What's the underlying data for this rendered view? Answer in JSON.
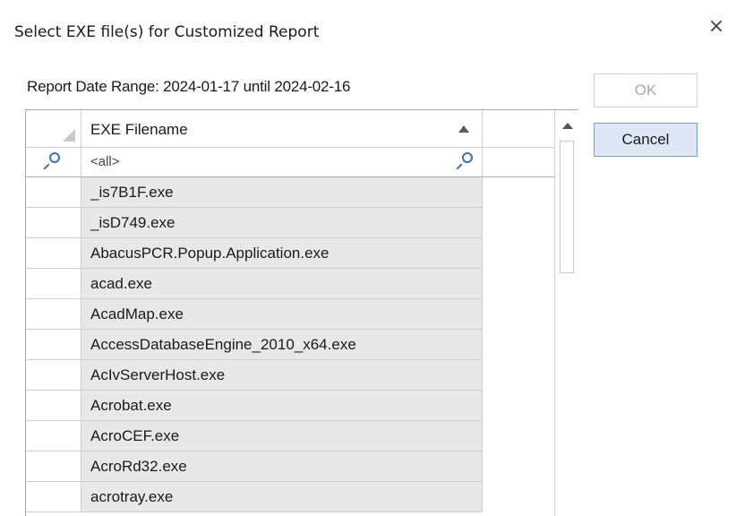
{
  "dialog": {
    "title": "Select EXE file(s) for Customized Report",
    "close_glyph": "×",
    "date_range": "Report Date Range: 2024-01-17 until 2024-02-16"
  },
  "buttons": {
    "ok_label": "OK",
    "cancel_label": "Cancel"
  },
  "grid": {
    "column_header": "EXE Filename",
    "filter_value": "<all>",
    "rows": [
      "_is7B1F.exe",
      "_isD749.exe",
      "AbacusPCR.Popup.Application.exe",
      "acad.exe",
      "AcadMap.exe",
      "AccessDatabaseEngine_2010_x64.exe",
      "AcIvServerHost.exe",
      "Acrobat.exe",
      "AcroCEF.exe",
      "AcroRd32.exe",
      "acrotray.exe"
    ]
  },
  "icons": {
    "filter": "search-icon",
    "sort": "sort-ascending-icon",
    "close": "close-icon"
  },
  "colors": {
    "accent": "#3b6fb6",
    "row_fill": "#e8e8e8",
    "cancel_fill": "#dde7f5"
  }
}
